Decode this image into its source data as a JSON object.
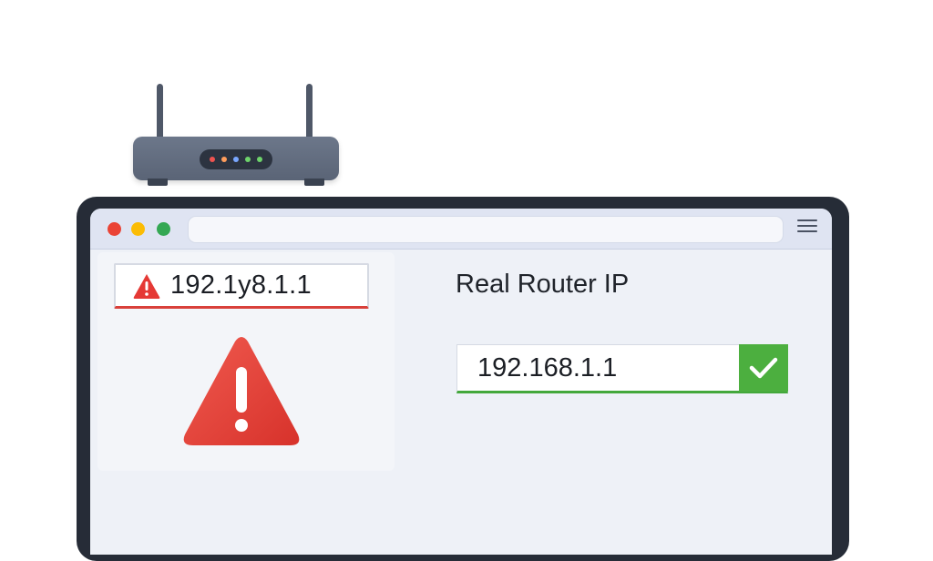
{
  "router": {
    "led_colors": [
      "#ef5350",
      "#ff9d5c",
      "#7aa7ff",
      "#6ed36b",
      "#6ed36b"
    ]
  },
  "browser": {
    "window_controls": [
      "close-dot",
      "minimize-dot",
      "maximize-dot"
    ],
    "address_bar_text": "",
    "menu_icon": "hamburger-icon"
  },
  "fake_panel": {
    "ip_text": "192.1y8.1.1",
    "status_color": "#d9403a",
    "icon": "warning-icon"
  },
  "real_panel": {
    "title": "Real Router IP",
    "ip_text": "192.168.1.1",
    "status_color": "#43a83c",
    "icon": "checkmark-icon"
  }
}
